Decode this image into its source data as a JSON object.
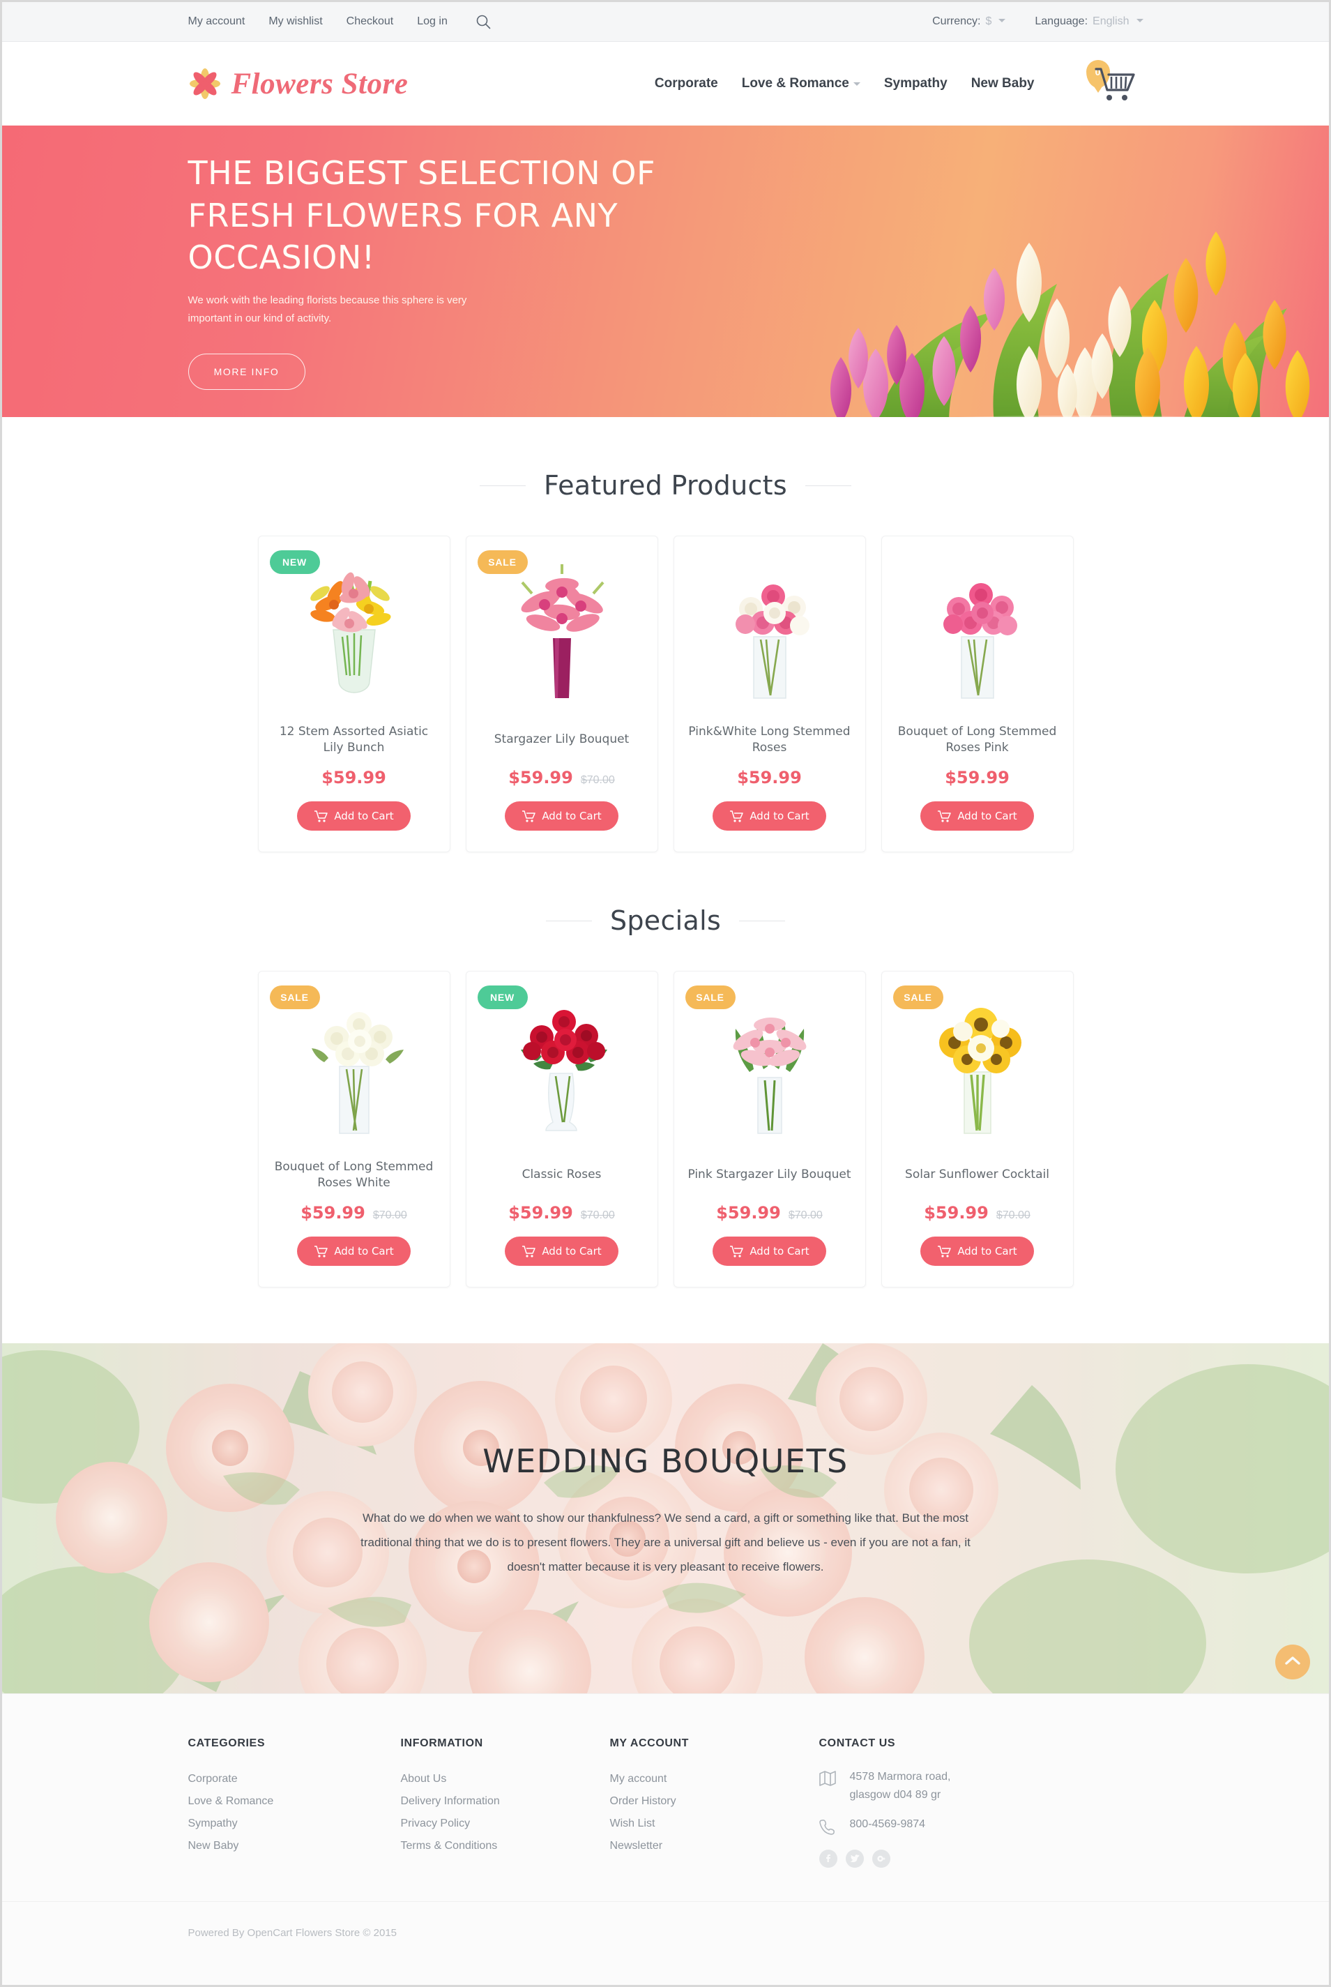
{
  "topbar": {
    "links": [
      {
        "label": "My account",
        "name": "my-account"
      },
      {
        "label": "My wishlist",
        "name": "my-wishlist"
      },
      {
        "label": "Checkout",
        "name": "checkout"
      },
      {
        "label": "Log in",
        "name": "log-in"
      }
    ],
    "search_icon": "search-icon",
    "currency": {
      "label": "Currency:",
      "value": "$"
    },
    "language": {
      "label": "Language:",
      "value": "English"
    }
  },
  "header": {
    "logo_text": "Flowers Store",
    "logo_icon": "flower-icon",
    "nav": [
      {
        "label": "Corporate",
        "has_dropdown": false
      },
      {
        "label": "Love & Romance",
        "has_dropdown": true
      },
      {
        "label": "Sympathy",
        "has_dropdown": false
      },
      {
        "label": "New Baby",
        "has_dropdown": false
      }
    ],
    "cart": {
      "icon": "shopping-cart-icon",
      "count": "0"
    }
  },
  "hero": {
    "title": "THE BIGGEST SELECTION OF FRESH FLOWERS FOR ANY OCCASION!",
    "subtitle": "We work with the leading florists because this sphere is very important in our kind of activity.",
    "button": "MORE INFO"
  },
  "featured": {
    "title": "Featured Products",
    "products": [
      {
        "name": "12 Stem Assorted Asiatic Lily Bunch",
        "price": "$59.99",
        "old_price": "",
        "badge": "NEW",
        "badge_type": "new",
        "button": "Add to Cart"
      },
      {
        "name": "Stargazer Lily Bouquet",
        "price": "$59.99",
        "old_price": "$70.00",
        "badge": "SALE",
        "badge_type": "sale",
        "button": "Add to Cart"
      },
      {
        "name": "Pink&White Long Stemmed Roses",
        "price": "$59.99",
        "old_price": "",
        "badge": "",
        "badge_type": "",
        "button": "Add to Cart"
      },
      {
        "name": "Bouquet of Long Stemmed Roses Pink",
        "price": "$59.99",
        "old_price": "",
        "badge": "",
        "badge_type": "",
        "button": "Add to Cart"
      }
    ]
  },
  "specials": {
    "title": "Specials",
    "products": [
      {
        "name": "Bouquet of Long Stemmed Roses White",
        "price": "$59.99",
        "old_price": "$70.00",
        "badge": "SALE",
        "badge_type": "sale",
        "button": "Add to Cart"
      },
      {
        "name": "Classic Roses",
        "price": "$59.99",
        "old_price": "$70.00",
        "badge": "NEW",
        "badge_type": "new",
        "button": "Add to Cart"
      },
      {
        "name": "Pink Stargazer Lily Bouquet",
        "price": "$59.99",
        "old_price": "$70.00",
        "badge": "SALE",
        "badge_type": "sale",
        "button": "Add to Cart"
      },
      {
        "name": "Solar Sunflower Cocktail",
        "price": "$59.99",
        "old_price": "$70.00",
        "badge": "SALE",
        "badge_type": "sale",
        "button": "Add to Cart"
      }
    ]
  },
  "wedding": {
    "title": "WEDDING BOUQUETS",
    "text": "What do we do when we want to show our thankfulness? We send a card, a gift or something like that. But the most traditional thing that we do is to present flowers. They are a universal gift and believe us - even if you are not a fan, it doesn't matter because it is very pleasant to receive flowers.",
    "to_top_icon": "chevron-up-icon"
  },
  "footer": {
    "categories": {
      "title": "CATEGORIES",
      "items": [
        "Corporate",
        "Love & Romance",
        "Sympathy",
        "New Baby"
      ]
    },
    "information": {
      "title": "INFORMATION",
      "items": [
        "About Us",
        "Delivery Information",
        "Privacy Policy",
        "Terms & Conditions"
      ]
    },
    "my_account": {
      "title": "MY ACCOUNT",
      "items": [
        "My account",
        "Order History",
        "Wish List",
        "Newsletter"
      ]
    },
    "contact": {
      "title": "CONTACT US",
      "address": "4578 Marmora road,\nglasgow d04 89 gr",
      "phone": "800-4569-9874",
      "address_icon": "map-icon",
      "phone_icon": "phone-icon",
      "socials": [
        "facebook-icon",
        "twitter-icon",
        "google-plus-icon"
      ]
    },
    "copyright": "Powered By OpenCart Flowers Store © 2015"
  },
  "colors": {
    "accent_pink": "#ef5f6d",
    "badge_new": "#4ecb97",
    "badge_sale": "#f5b957",
    "cart_badge": "#f6c36a",
    "to_top": "#f7b35c"
  }
}
